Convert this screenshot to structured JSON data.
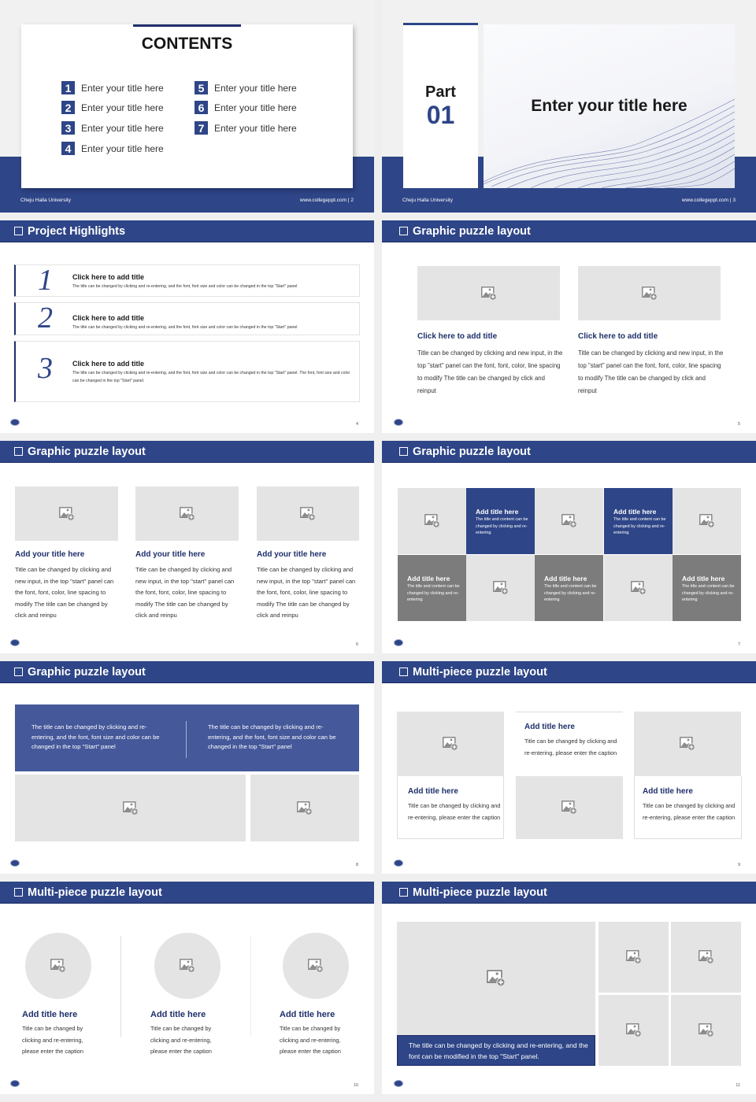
{
  "theme": {
    "accent": "#2e4587",
    "placeholder": "#e5e4e5",
    "tile_gray": "#7c7c7c"
  },
  "footer": {
    "university": "Cheju Halla University",
    "site": "www.collegeppt.com"
  },
  "slides": {
    "s2": {
      "title": "CONTENTS",
      "page": "www.collegeppt.com  |  2",
      "items": [
        {
          "num": "1",
          "label": "Enter your title here"
        },
        {
          "num": "2",
          "label": "Enter your title here"
        },
        {
          "num": "3",
          "label": "Enter your title here"
        },
        {
          "num": "4",
          "label": "Enter your title here"
        },
        {
          "num": "5",
          "label": "Enter your title here"
        },
        {
          "num": "6",
          "label": "Enter your title here"
        },
        {
          "num": "7",
          "label": "Enter your title here"
        }
      ]
    },
    "s3": {
      "part": "Part",
      "number": "01",
      "title": "Enter your title here",
      "page": "www.collegeppt.com  |  3"
    },
    "s4": {
      "header": "Project Highlights",
      "page": "4",
      "items": [
        {
          "num": "1",
          "title": "Click here to add title",
          "desc": "The title can be changed by clicking and re-entering, and the font, font size and color can be changed in the top \"Start\" panel"
        },
        {
          "num": "2",
          "title": "Click here to add title",
          "desc": "The title can be changed by clicking and re-entering, and the font, font size and color can be changed in the top \"Start\" panel"
        },
        {
          "num": "3",
          "title": "Click here to add title",
          "desc": "The title can be changed by clicking and re-entering, and the font, font size and color can be changed in the top \"Start\" panel. The font, font size and color can be changed in the top \"Start\" panel."
        }
      ]
    },
    "s5": {
      "header": "Graphic puzzle layout",
      "page": "5",
      "items": [
        {
          "title": "Click here to add title",
          "desc": "Title can be changed by clicking and new input, in the top \"start\" panel can the font, font, color, line spacing to modify The title can be changed by click and reinput"
        },
        {
          "title": "Click here to add title",
          "desc": "Title can be changed by clicking and new input, in the top \"start\" panel can the font, font, color, line spacing to modify The title can be changed by click and reinput"
        }
      ]
    },
    "s6": {
      "header": "Graphic puzzle layout",
      "page": "6",
      "items": [
        {
          "title": "Add your title here",
          "desc": "Title can be changed by clicking and new input, in the top \"start\" panel can the font, font, color, line spacing to modify The title can be changed by click and reinpu"
        },
        {
          "title": "Add your title here",
          "desc": "Title can be changed by clicking and new input, in the top \"start\" panel can the font, font, color, line spacing to modify The title can be changed by click and reinpu"
        },
        {
          "title": "Add your title here",
          "desc": "Title can be changed by clicking and new input, in the top \"start\" panel can the font, font, color, line spacing to modify The title can be changed by click and reinpu"
        }
      ]
    },
    "s7": {
      "header": "Graphic puzzle layout",
      "page": "7",
      "tiles": [
        {
          "title": "Add title here",
          "desc": "The title and content can be changed by clicking and re-entering"
        },
        {
          "title": "Add title here",
          "desc": "The title and content can be changed by clicking and re-entering"
        },
        {
          "title": "Add title here",
          "desc": "The title and content can be changed by clicking and re-entering"
        },
        {
          "title": "Add title here",
          "desc": "The title and content can be changed by clicking and re-entering"
        },
        {
          "title": "Add title here",
          "desc": "The title and content can be changed by clicking and re-entering"
        }
      ]
    },
    "s8": {
      "header": "Graphic puzzle layout",
      "page": "8",
      "texts": [
        "The title can be changed by clicking and re-entering, and the font, font size and color can be changed in the top \"Start\" panel",
        "The title can be changed by clicking and re-entering, and the font, font size and color can be changed in the top \"Start\" panel"
      ]
    },
    "s9": {
      "header": "Multi-piece puzzle layout",
      "page": "9",
      "items": [
        {
          "title": "Add title here",
          "desc": "Title can be changed by clicking and re-entering, please enter the caption"
        },
        {
          "title": "Add title here",
          "desc": "Title can be changed by clicking and re-entering, please enter the caption"
        },
        {
          "title": "Add title here",
          "desc": "Title can be changed by clicking and re-entering, please enter the caption"
        }
      ]
    },
    "s10": {
      "header": "Multi-piece puzzle layout",
      "page": "10",
      "items": [
        {
          "title": "Add title here",
          "desc": "Title can be changed by clicking and re-entering, please enter the caption"
        },
        {
          "title": "Add title here",
          "desc": "Title can be changed by clicking and re-entering, please enter the caption"
        },
        {
          "title": "Add title here",
          "desc": "Title can be changed by clicking and re-entering, please enter the caption"
        }
      ]
    },
    "s11": {
      "header": "Multi-piece puzzle layout",
      "page": "11",
      "caption": "The title can be changed by clicking and re-entering, and the font can be modified in the top \"Start\" panel."
    }
  }
}
